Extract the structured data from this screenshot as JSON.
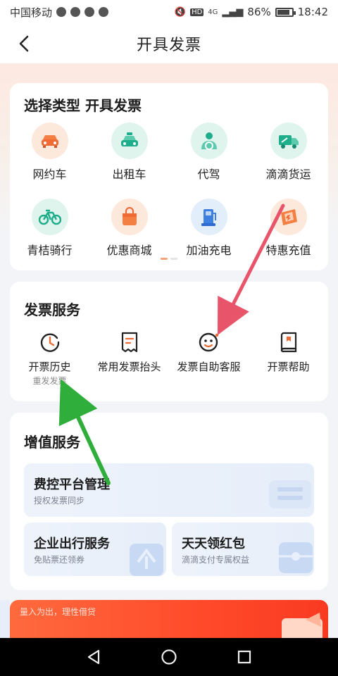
{
  "status_bar": {
    "carrier": "中国移动",
    "network": "4G",
    "hd": "HD",
    "battery_pct": "86%",
    "time": "18:42"
  },
  "header": {
    "title": "开具发票"
  },
  "invoice_types": {
    "title": "选择类型 开具发票",
    "items": [
      {
        "label": "网约车",
        "icon": "car-icon"
      },
      {
        "label": "出租车",
        "icon": "taxi-icon"
      },
      {
        "label": "代驾",
        "icon": "driver-icon"
      },
      {
        "label": "滴滴货运",
        "icon": "truck-icon"
      },
      {
        "label": "青桔骑行",
        "icon": "bike-icon"
      },
      {
        "label": "优惠商城",
        "icon": "shopping-bag-icon"
      },
      {
        "label": "加油充电",
        "icon": "fuel-pump-icon"
      },
      {
        "label": "特惠充值",
        "icon": "recharge-icon"
      }
    ]
  },
  "invoice_services": {
    "title": "发票服务",
    "items": [
      {
        "label": "开票历史",
        "sub": "重发发票",
        "icon": "clock-icon"
      },
      {
        "label": "常用发票抬头",
        "sub": "",
        "icon": "receipt-icon"
      },
      {
        "label": "发票自助客服",
        "sub": "",
        "icon": "customer-service-icon"
      },
      {
        "label": "开票帮助",
        "sub": "",
        "icon": "help-book-icon"
      }
    ]
  },
  "value_services": {
    "title": "增值服务",
    "tiles": [
      {
        "name": "费控平台管理",
        "sub": "授权发票同步"
      },
      {
        "name": "企业出行服务",
        "sub": "免贴票还领券"
      },
      {
        "name": "天天领红包",
        "sub": "滴滴支付专属权益"
      }
    ]
  },
  "banner": {
    "text": "量入为出，理性借贷"
  },
  "colors": {
    "accent_orange": "#f06a35",
    "accent_green": "#1fae8c",
    "annotation_red": "#e8556a",
    "annotation_green": "#2fae3c"
  }
}
